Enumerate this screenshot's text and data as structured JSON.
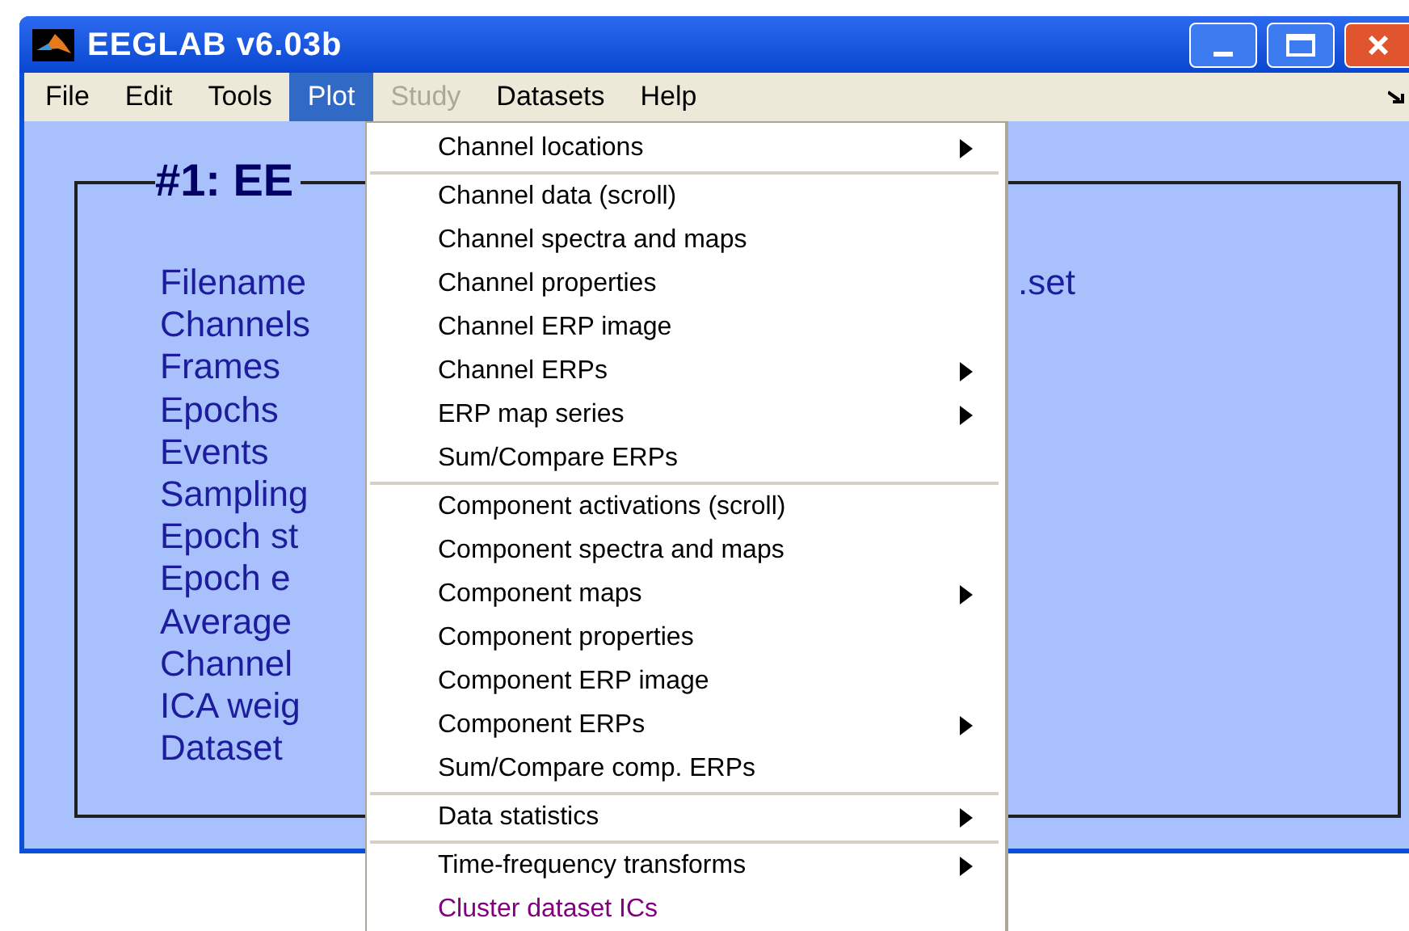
{
  "window": {
    "title": "EEGLAB v6.03b"
  },
  "menu_bar": [
    {
      "label": "File",
      "selected": false,
      "disabled": false
    },
    {
      "label": "Edit",
      "selected": false,
      "disabled": false
    },
    {
      "label": "Tools",
      "selected": false,
      "disabled": false
    },
    {
      "label": "Plot",
      "selected": true,
      "disabled": false
    },
    {
      "label": "Study",
      "selected": false,
      "disabled": true
    },
    {
      "label": "Datasets",
      "selected": false,
      "disabled": false
    },
    {
      "label": "Help",
      "selected": false,
      "disabled": false
    }
  ],
  "frame": {
    "title": "#1: EE",
    "labels": [
      "Filename",
      "Channels",
      "Frames",
      "Epochs",
      "Events",
      "Sampling",
      "Epoch st",
      "Epoch e",
      "Average",
      "Channel",
      "ICA weig",
      "Dataset"
    ],
    "filename_end": ".set"
  },
  "dropdown": {
    "groups": [
      [
        {
          "label": "Channel locations",
          "submenu": true,
          "color": "#000000"
        }
      ],
      [
        {
          "label": "Channel data (scroll)",
          "submenu": false,
          "color": "#000000"
        },
        {
          "label": "Channel spectra and maps",
          "submenu": false,
          "color": "#000000"
        },
        {
          "label": "Channel properties",
          "submenu": false,
          "color": "#000000"
        },
        {
          "label": "Channel ERP image",
          "submenu": false,
          "color": "#000000"
        },
        {
          "label": "Channel ERPs",
          "submenu": true,
          "color": "#000000"
        },
        {
          "label": "ERP map series",
          "submenu": true,
          "color": "#000000"
        },
        {
          "label": "Sum/Compare ERPs",
          "submenu": false,
          "color": "#000000"
        }
      ],
      [
        {
          "label": "Component activations (scroll)",
          "submenu": false,
          "color": "#000000"
        },
        {
          "label": "Component spectra and maps",
          "submenu": false,
          "color": "#000000"
        },
        {
          "label": "Component maps",
          "submenu": true,
          "color": "#000000"
        },
        {
          "label": "Component properties",
          "submenu": false,
          "color": "#000000"
        },
        {
          "label": "Component ERP image",
          "submenu": false,
          "color": "#000000"
        },
        {
          "label": "Component ERPs",
          "submenu": true,
          "color": "#000000"
        },
        {
          "label": "Sum/Compare comp. ERPs",
          "submenu": false,
          "color": "#000000"
        }
      ],
      [
        {
          "label": "Data statistics",
          "submenu": true,
          "color": "#000000"
        }
      ],
      [
        {
          "label": "Time-frequency transforms",
          "submenu": true,
          "color": "#000000"
        },
        {
          "label": "Cluster dataset ICs",
          "submenu": false,
          "color": "#800080"
        }
      ]
    ]
  }
}
